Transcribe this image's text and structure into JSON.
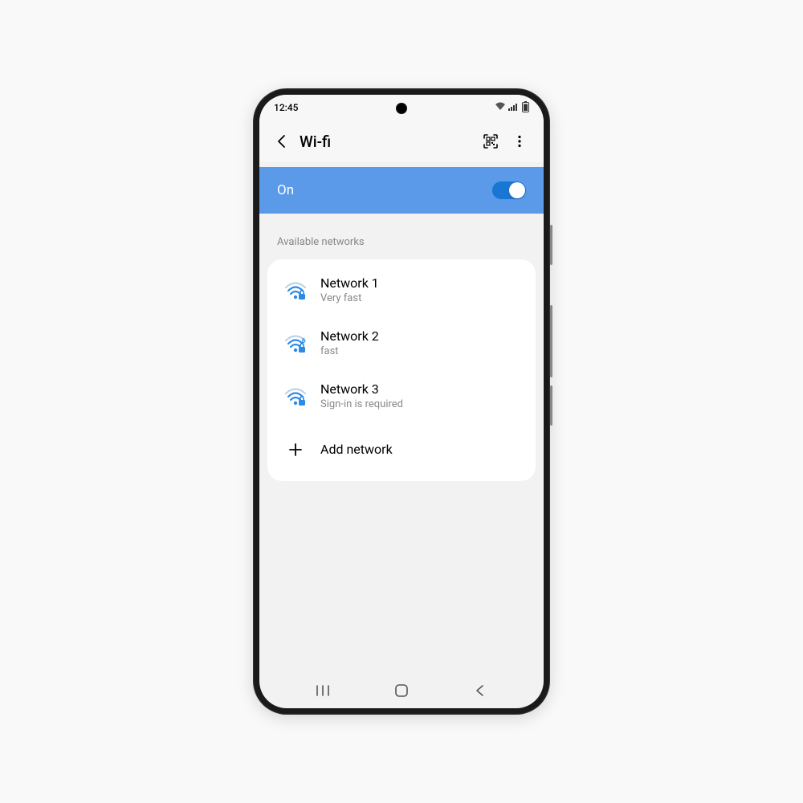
{
  "status_bar": {
    "time": "12:45"
  },
  "app_bar": {
    "title": "Wi-fi"
  },
  "toggle": {
    "label": "On",
    "state": true
  },
  "sections": {
    "available_header": "Available networks"
  },
  "networks": [
    {
      "name": "Network 1",
      "sub": "Very fast",
      "wifi6": false
    },
    {
      "name": "Network 2",
      "sub": "fast",
      "wifi6": true
    },
    {
      "name": "Network 3",
      "sub": "Sign-in is required",
      "wifi6": false
    }
  ],
  "add_network": {
    "label": "Add network"
  }
}
